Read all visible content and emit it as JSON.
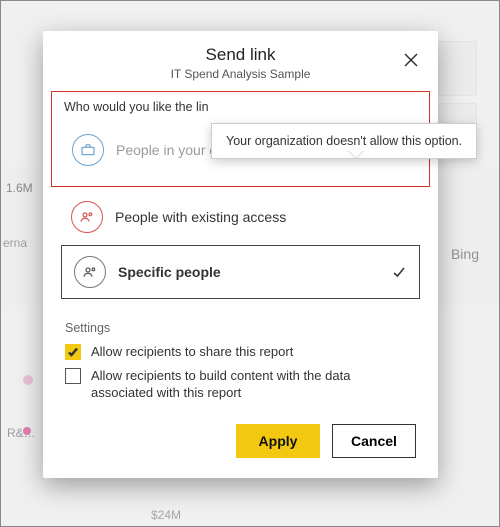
{
  "dialog": {
    "title": "Send link",
    "subtitle": "IT Spend Analysis Sample",
    "prompt": "Who would you like the lin",
    "options": {
      "org": {
        "label": "People in your organization"
      },
      "existing": {
        "label": "People with existing access"
      },
      "specific": {
        "label": "Specific people"
      }
    },
    "tooltip": "Your organization doesn't allow this option.",
    "settings_label": "Settings",
    "setting_allow_share": {
      "label": "Allow recipients to share this report",
      "checked": true
    },
    "setting_allow_build": {
      "label": "Allow recipients to build content with the data associated with this report",
      "checked": false
    },
    "apply_label": "Apply",
    "cancel_label": "Cancel"
  },
  "background": {
    "value_1_6m": "1.6M",
    "label_erna": "erna",
    "label_rnd": "R&…",
    "bing": "Bing",
    "value_24m": "$24M"
  }
}
